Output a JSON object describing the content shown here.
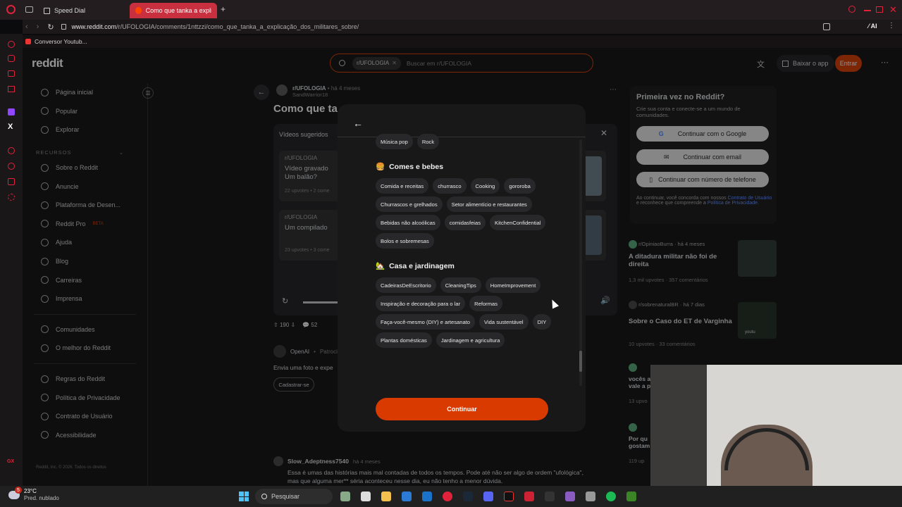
{
  "browser": {
    "tabs": [
      {
        "label": "Speed Dial"
      },
      {
        "label": "Como que tanka a explicaç"
      }
    ],
    "url_prefix": "www.reddit.com",
    "url_path": "/r/UFOLOGIA/comments/1nttzzi/como_que_tanka_a_explicação_dos_militares_sobre/",
    "bookmark": "Conversor Youtub...",
    "ai_label": "AI"
  },
  "header": {
    "logo": "reddit",
    "search_chip": "r/UFOLOGIA",
    "search_placeholder": "Buscar em r/UFOLOGIA",
    "download_app": "Baixar o app",
    "login": "Entrar"
  },
  "sidebar": {
    "top_items": [
      "Página inicial",
      "Popular",
      "Explorar"
    ],
    "resources_title": "RECURSOS",
    "resources": [
      "Sobre o Reddit",
      "Anuncie",
      "Plataforma de Desen...",
      "Reddit Pro",
      "Ajuda",
      "Blog",
      "Carreiras",
      "Imprensa"
    ],
    "beta": "BETA",
    "community_items": [
      "Comunidades",
      "O melhor do Reddit"
    ],
    "legal_items": [
      "Regras do Reddit",
      "Política de Privacidade",
      "Contrato de Usuário",
      "Acessibilidade"
    ],
    "copyright": "Reddit, Inc. © 2026. Todos os direitos"
  },
  "post": {
    "subreddit": "r/UFOLOGIA",
    "age": "há 4 meses",
    "author": "SandWarrior18",
    "title": "Como que ta",
    "suggested": "Vídeos sugeridos",
    "suggest1_sub": "r/UFOLOGIA",
    "suggest1_title": "Vídeo gravado",
    "suggest1_title2": "Um balão?",
    "suggest1_meta": "22 upvotes • 2 come",
    "suggest2_sub": "r/UFOLOGIA",
    "suggest2_title": "Um compilado",
    "suggest2_meta": "23 upvotes • 3 come",
    "upvotes": "190",
    "comments": "52",
    "ad_name": "OpenAI",
    "ad_tag": "Patroci",
    "ad_text": "Envia uma foto e expe",
    "ad_button": "Cadastrar-se",
    "comment_author": "Slow_Adeptness7540",
    "comment_age": "há 4 meses",
    "comment_line1": "Essa é umas das histórias mais mal contadas de todos os tempos. Pode até não ser algo de ordem \"ufológica\",",
    "comment_line2": "mas que alguma mer** séria aconteceu nesse dia, eu não tenho a menor dúvida."
  },
  "signup": {
    "title": "Primeira vez no Reddit?",
    "subtitle": "Crie sua conta e conecte-se a um mundo de comunidades.",
    "google": "Continuar com o Google",
    "email": "Continuar com email",
    "phone": "Continuar com número de telefone",
    "terms_a": "Ao continuar, você concorda com nossos",
    "terms_link1": "Contrato de Usuário",
    "terms_b": "e reconhece que compreende a",
    "terms_link2": "Política de Privacidade."
  },
  "related": [
    {
      "sub": "r/OpiniaoBurra",
      "age": "há 4 meses",
      "title": "A ditadura militar não foi de direita",
      "meta": "1,3 mil upvotes · 357 comentários"
    },
    {
      "sub": "r/sobrenaturalBR",
      "age": "há 7 dias",
      "title": "Sobre o Caso do ET de Varginha",
      "meta": "10 upvotes · 33 comentários",
      "thumb": "youtu"
    },
    {
      "title": "vocês a",
      "title2": "vale a p",
      "meta": "13 upvo"
    },
    {
      "title": "Por qu",
      "title2": "gostam",
      "meta": "119 up"
    }
  ],
  "modal": {
    "top_chips": [
      "Música pop",
      "Rock"
    ],
    "sections": [
      {
        "icon": "🍔",
        "title": "Comes e bebes",
        "chips": [
          "Comida e receitas",
          "churrasco",
          "Cooking",
          "gororoba",
          "Churrascos e grelhados",
          "Setor alimentício e restaurantes",
          "Bebidas não alcoólicas",
          "comidasfeias",
          "KitchenConfidential",
          "Bolos e sobremesas"
        ]
      },
      {
        "icon": "🏡",
        "title": "Casa e jardinagem",
        "chips": [
          "CadeirasDeEscritorio",
          "CleaningTips",
          "HomeImprovement",
          "Inspiração e decoração para o lar",
          "Reformas",
          "Faça-você-mesmo (DIY) e artesanato",
          "Vida sustentável",
          "DIY",
          "Plantas domésticas",
          "Jardinagem e agricultura"
        ]
      }
    ],
    "continue": "Continuar"
  },
  "taskbar": {
    "temp": "23°C",
    "weather": "Pred. nublado",
    "badge": "5",
    "search": "Pesquisar"
  },
  "colors": {
    "accent": "#d93a00",
    "opera_red": "#e0223b"
  }
}
